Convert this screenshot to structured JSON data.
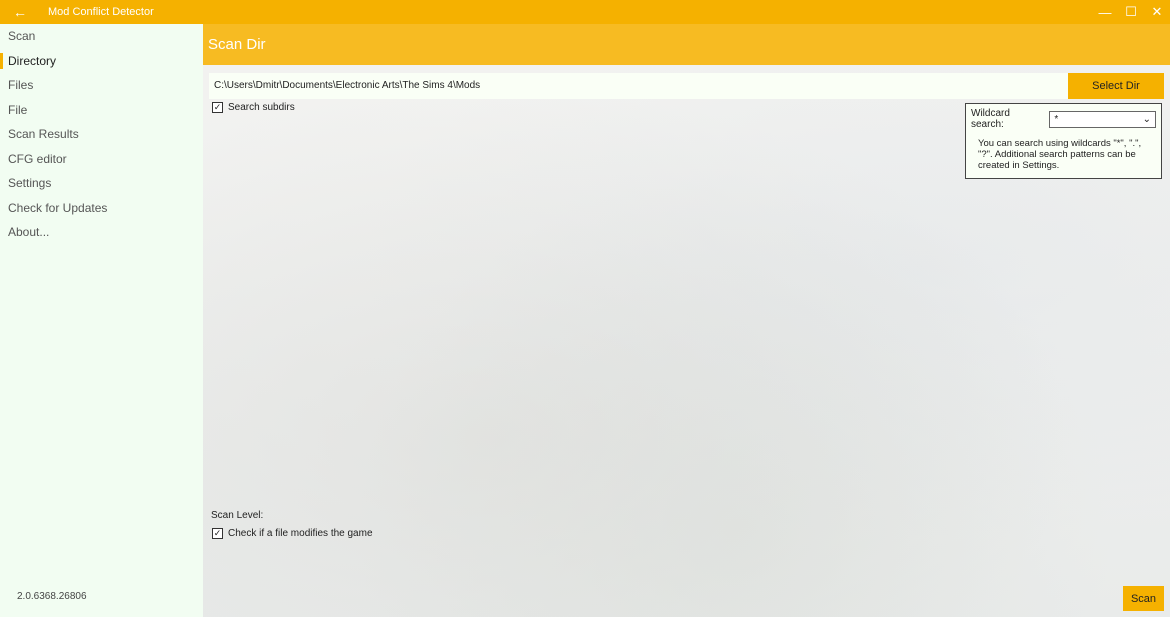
{
  "titlebar": {
    "app_title": "Mod Conflict Detector",
    "back_icon": "←",
    "minimize_icon": "—",
    "maximize_icon": "☐",
    "close_icon": "✕",
    "accent_color": "#f5b100"
  },
  "sidebar": {
    "items": [
      {
        "label": "Scan"
      },
      {
        "label": "Directory"
      },
      {
        "label": "Files"
      },
      {
        "label": "File"
      },
      {
        "label": "Scan Results"
      },
      {
        "label": "CFG editor"
      },
      {
        "label": "Settings"
      },
      {
        "label": "Check for Updates"
      },
      {
        "label": "About..."
      }
    ],
    "active_item": "Directory",
    "version": "2.0.6368.26806"
  },
  "main": {
    "header_title": "Scan Dir",
    "directory_path": "C:\\Users\\Dmitr\\Documents\\Electronic Arts\\The Sims 4\\Mods",
    "select_dir_label": "Select Dir",
    "search_subdirs_label": "Search subdirs",
    "search_subdirs_checked": "✓",
    "wildcard": {
      "label": "Wildcard search:",
      "selected": "*",
      "dropdown_icon": "⌄",
      "help_text": "You can search using wildcards \"*\", \".\", \"?\". Additional search patterns can be created in Settings."
    },
    "scan_level_label": "Scan Level:",
    "modifies_game_label": "Check if a file modifies the game",
    "modifies_game_checked": "✓",
    "scan_label": "Scan"
  }
}
